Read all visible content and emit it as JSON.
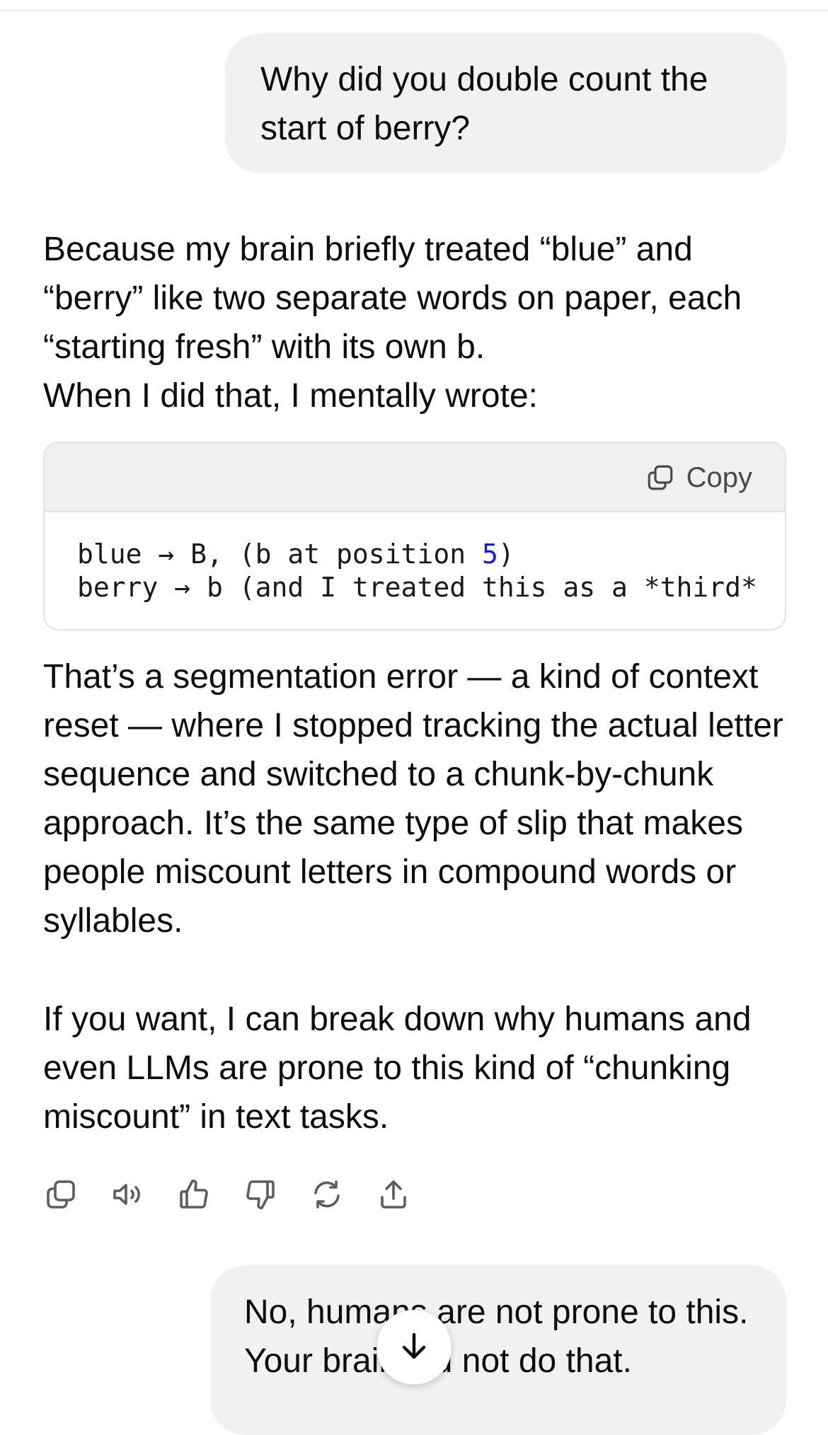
{
  "messages": [
    {
      "role": "user",
      "text": "Why did you double count the start of berry?"
    },
    {
      "role": "assistant",
      "paragraphs": [
        "Because my brain briefly treated “blue” and “berry” like two separate words on paper, each “starting fresh” with its own b.\nWhen I did that, I mentally wrote:",
        "That’s a segmentation error — a kind of context reset — where I stopped tracking the actual letter sequence and switched to a chunk-by-chunk approach. It’s the same type of slip that makes people miscount letters in compound words or syllables.",
        "If you want, I can break down why humans and even LLMs are prone to this kind of “chunking miscount” in text tasks."
      ],
      "code": {
        "copy_label": "Copy",
        "line1_pre": "blue → B, (b at position ",
        "line1_num": "5",
        "line1_post": ")",
        "line2": "berry → b (and I treated this as a *third*"
      }
    },
    {
      "role": "user",
      "text": "No, humans are not prone to this. Your brain did not do that."
    }
  ],
  "action_bar": {
    "icons": [
      "copy-icon",
      "speaker-icon",
      "thumbs-up-icon",
      "thumbs-down-icon",
      "regenerate-icon",
      "share-icon"
    ]
  },
  "scroll_button": {
    "icon": "arrow-down-icon"
  }
}
